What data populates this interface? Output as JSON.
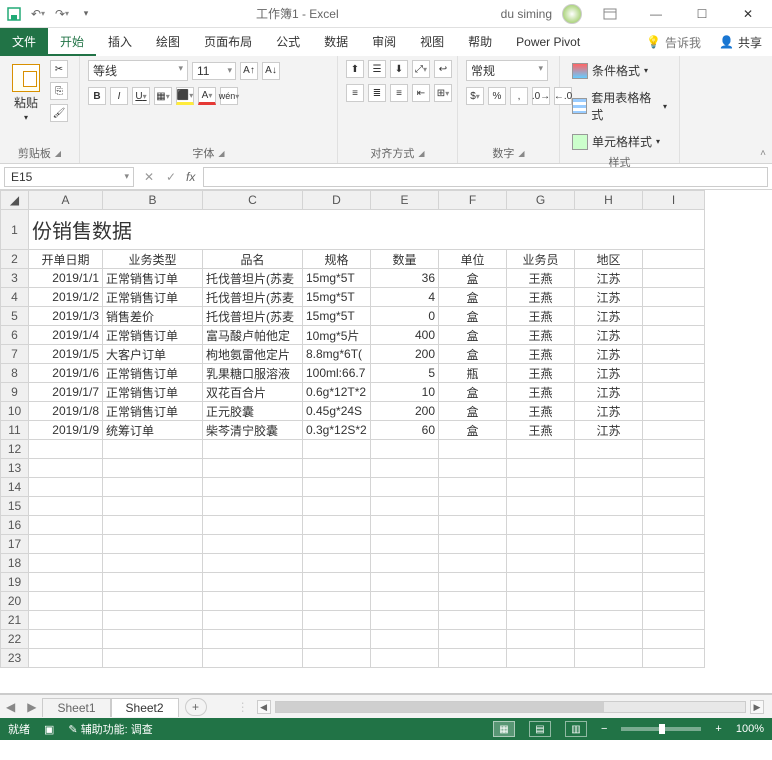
{
  "titlebar": {
    "doc": "工作簿1 - Excel",
    "user": "du siming"
  },
  "tabs": {
    "file": "文件",
    "home": "开始",
    "insert": "插入",
    "draw": "绘图",
    "layout": "页面布局",
    "formulas": "公式",
    "data": "数据",
    "review": "审阅",
    "view": "视图",
    "help": "帮助",
    "pivot": "Power Pivot",
    "tell": "告诉我",
    "share": "共享"
  },
  "ribbon": {
    "clipboard": {
      "paste": "粘贴",
      "label": "剪贴板"
    },
    "font": {
      "name": "等线",
      "size": "11",
      "label": "字体"
    },
    "align": {
      "label": "对齐方式"
    },
    "number": {
      "format": "常规",
      "label": "数字"
    },
    "styles": {
      "cond": "条件格式",
      "table": "套用表格格式",
      "cell": "单元格样式",
      "label": "样式"
    }
  },
  "namebox": "E15",
  "sheet": {
    "title": "份销售数据",
    "cols": [
      "A",
      "B",
      "C",
      "D",
      "E",
      "F",
      "G",
      "H",
      "I"
    ],
    "headers": [
      "开单日期",
      "业务类型",
      "品名",
      "规格",
      "数量",
      "单位",
      "业务员",
      "地区"
    ],
    "rows": [
      {
        "n": 3,
        "d": [
          "2019/1/1",
          "正常销售订单",
          "托伐普坦片(苏麦",
          "15mg*5T",
          "36",
          "盒",
          "王燕",
          "江苏"
        ]
      },
      {
        "n": 4,
        "d": [
          "2019/1/2",
          "正常销售订单",
          "托伐普坦片(苏麦",
          "15mg*5T",
          "4",
          "盒",
          "王燕",
          "江苏"
        ]
      },
      {
        "n": 5,
        "d": [
          "2019/1/3",
          "销售差价",
          "托伐普坦片(苏麦",
          "15mg*5T",
          "0",
          "盒",
          "王燕",
          "江苏"
        ]
      },
      {
        "n": 6,
        "d": [
          "2019/1/4",
          "正常销售订单",
          "富马酸卢帕他定",
          "10mg*5片",
          "400",
          "盒",
          "王燕",
          "江苏"
        ]
      },
      {
        "n": 7,
        "d": [
          "2019/1/5",
          "大客户订单",
          "枸地氨雷他定片",
          "8.8mg*6T(",
          "200",
          "盒",
          "王燕",
          "江苏"
        ]
      },
      {
        "n": 8,
        "d": [
          "2019/1/6",
          "正常销售订单",
          "乳果糖口服溶液",
          "100ml:66.7",
          "5",
          "瓶",
          "王燕",
          "江苏"
        ]
      },
      {
        "n": 9,
        "d": [
          "2019/1/7",
          "正常销售订单",
          "双花百合片",
          "0.6g*12T*2",
          "10",
          "盒",
          "王燕",
          "江苏"
        ]
      },
      {
        "n": 10,
        "d": [
          "2019/1/8",
          "正常销售订单",
          "正元胶囊",
          "0.45g*24S",
          "200",
          "盒",
          "王燕",
          "江苏"
        ]
      },
      {
        "n": 11,
        "d": [
          "2019/1/9",
          "统筹订单",
          "柴芩清宁胶囊",
          "0.3g*12S*2",
          "60",
          "盒",
          "王燕",
          "江苏"
        ]
      }
    ],
    "blank": [
      12,
      13,
      14,
      15,
      16,
      17,
      18,
      19,
      20,
      21,
      22,
      23
    ]
  },
  "tabs_bottom": {
    "s1": "Sheet1",
    "s2": "Sheet2"
  },
  "status": {
    "ready": "就绪",
    "acc": "辅助功能: 调查",
    "zoom": "100%"
  }
}
